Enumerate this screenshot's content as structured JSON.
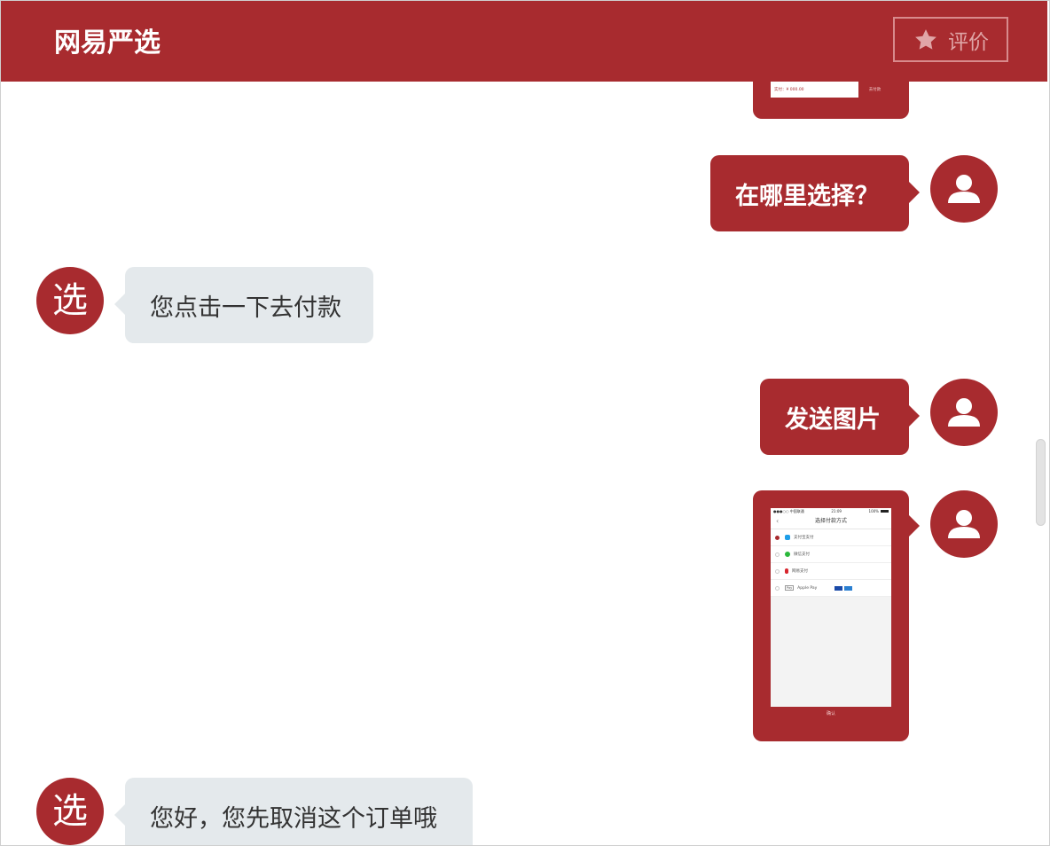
{
  "header": {
    "brand": "网易严选",
    "rate_label": "评价",
    "rate_icon": "star-icon"
  },
  "colors": {
    "accent": "#a82b2f",
    "incoming_bubble": "#e4e9ec",
    "outgoing_text": "#ffffff",
    "incoming_text": "#333333"
  },
  "bot_avatar": {
    "glyph": "选"
  },
  "messages": [
    {
      "from": "user",
      "type": "image_partial",
      "image": {
        "amount_text": "实付：¥ 000.00",
        "pay_button": "去付款"
      }
    },
    {
      "from": "user",
      "type": "text",
      "text": "在哪里选择？"
    },
    {
      "from": "bot",
      "type": "text",
      "text": "您点击一下去付款"
    },
    {
      "from": "user",
      "type": "text",
      "text": "发送图片"
    },
    {
      "from": "user",
      "type": "image",
      "image": {
        "status": {
          "carrier": "●●●○○ 中国联通",
          "time": "21:09",
          "battery": "100%"
        },
        "title": "选择付款方式",
        "options": [
          {
            "label": "支付宝支付",
            "selected": true,
            "icon_color": "#1e9ee8"
          },
          {
            "label": "微信支付",
            "selected": false,
            "icon_color": "#2bb83b"
          },
          {
            "label": "网易支付",
            "selected": false,
            "icon_color": "#d8262f"
          },
          {
            "label": "Apple Pay",
            "selected": false,
            "icon_color": "#888888"
          }
        ],
        "footer": "确认"
      }
    },
    {
      "from": "bot",
      "type": "text",
      "text": "您好，您先取消这个订单哦"
    }
  ]
}
